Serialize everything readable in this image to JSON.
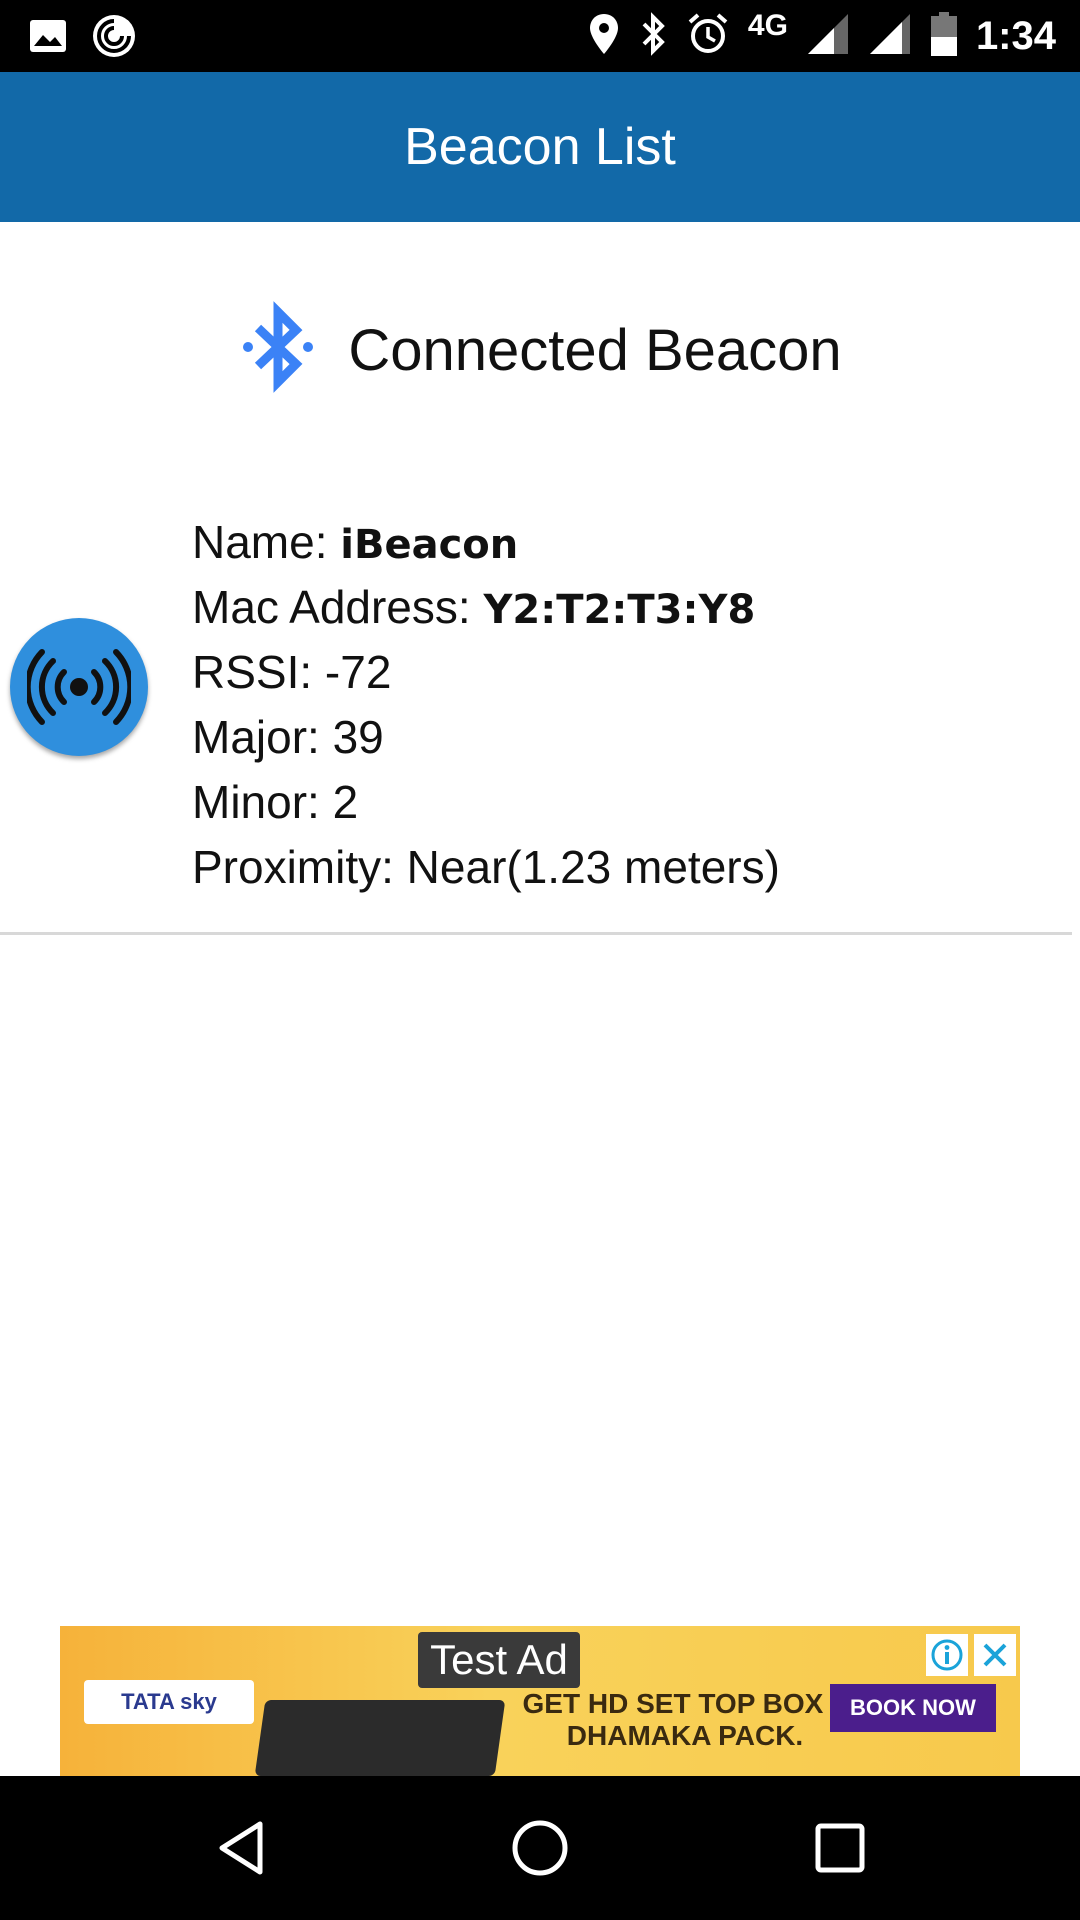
{
  "status_bar": {
    "time": "1:34",
    "network": "4G",
    "left_icons": [
      "gallery-icon",
      "app-notification-icon"
    ],
    "right_icons": [
      "location-icon",
      "bluetooth-icon",
      "alarm-icon",
      "signal-icon",
      "signal-icon",
      "battery-icon"
    ]
  },
  "app_bar": {
    "title": "Beacon List"
  },
  "connected": {
    "title": "Connected Beacon",
    "icon": "bluetooth-icon",
    "icon_color": "#3b82f6"
  },
  "beacon": {
    "name_label": "Name: ",
    "name_value": "iBeacon",
    "mac_label": "Mac Address: ",
    "mac_value": "Y2:T2:T3:Y8",
    "rssi": "RSSI: -72",
    "major": "Major: 39",
    "minor": "Minor: 2",
    "proximity": "Proximity: Near(1.23 meters)",
    "avatar_color": "#2f8fdd"
  },
  "ad": {
    "badge": "Test Ad",
    "brand": "TATA sky",
    "headline": "GET HD SET TOP BOX + DHAMAKA PACK.",
    "cta": "BOOK NOW"
  },
  "colors": {
    "app_bar": "#1269a8",
    "status_bar": "#000000",
    "nav_bar": "#000000"
  }
}
